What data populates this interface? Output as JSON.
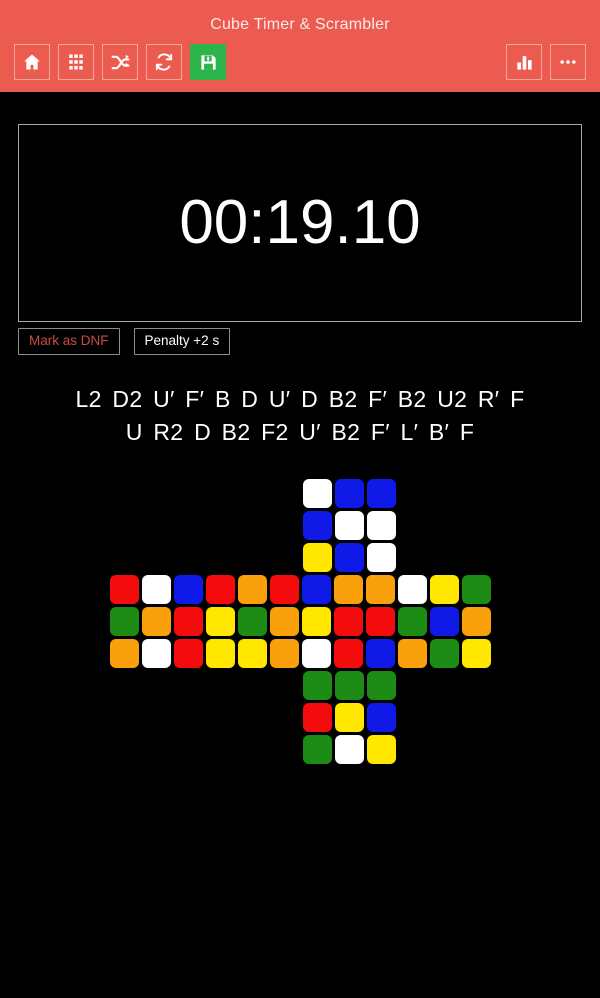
{
  "app": {
    "title": "Cube Timer & Scrambler",
    "header_color": "#ec5b4f",
    "accent_color": "#2db44b",
    "background_color": "#000000"
  },
  "toolbar": {
    "left_buttons": [
      {
        "name": "home-icon",
        "label": "Home"
      },
      {
        "name": "grid-icon",
        "label": "Sessions"
      },
      {
        "name": "shuffle-icon",
        "label": "Scramble"
      },
      {
        "name": "refresh-icon",
        "label": "Reset"
      },
      {
        "name": "save-icon",
        "label": "Save",
        "highlighted": true
      }
    ],
    "right_buttons": [
      {
        "name": "bar-chart-icon",
        "label": "Statistics"
      },
      {
        "name": "more-options-icon",
        "label": "More options"
      }
    ]
  },
  "timer": {
    "value": "00:19.10"
  },
  "penalties": {
    "dnf_label": "Mark as DNF",
    "dnf_color": "#c94a42",
    "plus_two_label": "Penalty +2 s"
  },
  "scramble": {
    "line1": "L2 D2 U′ F′ B D U′ D B2 F′ B2 U2 R′ F",
    "line2": "U R2 D B2 F2 U′ B2 F′ L′ B′ F"
  },
  "cube": {
    "colors": {
      "W": "#ffffff",
      "Y": "#ffe700",
      "R": "#f40c0c",
      "O": "#faa00a",
      "B": "#0f19e8",
      "G": "#1d8c14"
    },
    "faces": {
      "up": [
        [
          "W",
          "B",
          "B"
        ],
        [
          "B",
          "W",
          "W"
        ],
        [
          "Y",
          "B",
          "W"
        ]
      ],
      "left": [
        [
          "R",
          "W",
          "B"
        ],
        [
          "G",
          "O",
          "R"
        ],
        [
          "O",
          "W",
          "R"
        ]
      ],
      "front": [
        [
          "R",
          "O",
          "R"
        ],
        [
          "Y",
          "G",
          "O"
        ],
        [
          "Y",
          "Y",
          "O"
        ]
      ],
      "right": [
        [
          "B",
          "O",
          "O"
        ],
        [
          "Y",
          "R",
          "R"
        ],
        [
          "W",
          "R",
          "B"
        ]
      ],
      "back": [
        [
          "W",
          "Y",
          "G"
        ],
        [
          "G",
          "B",
          "O"
        ],
        [
          "O",
          "G",
          "Y"
        ]
      ],
      "down": [
        [
          "G",
          "G",
          "G"
        ],
        [
          "R",
          "Y",
          "B"
        ],
        [
          "G",
          "W",
          "Y"
        ]
      ]
    }
  }
}
